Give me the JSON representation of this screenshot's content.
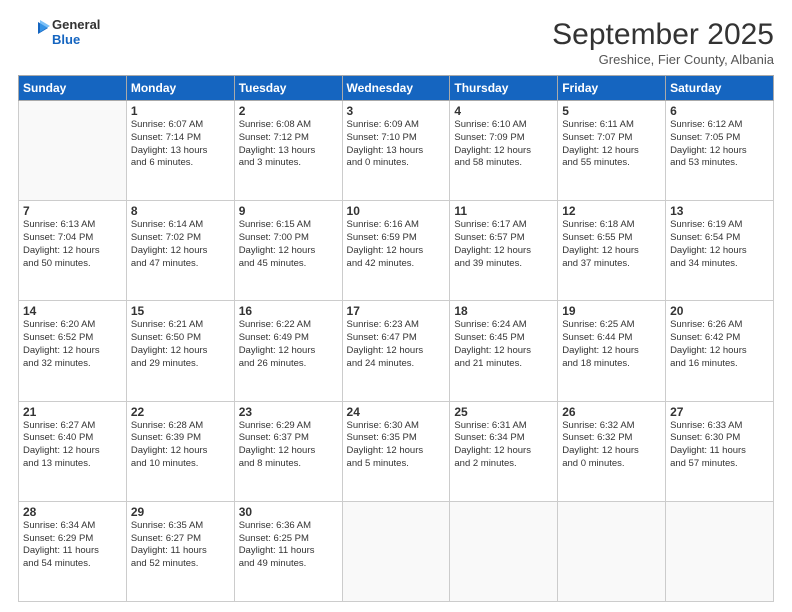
{
  "logo": {
    "text_general": "General",
    "text_blue": "Blue"
  },
  "header": {
    "month": "September 2025",
    "location": "Greshice, Fier County, Albania"
  },
  "days_of_week": [
    "Sunday",
    "Monday",
    "Tuesday",
    "Wednesday",
    "Thursday",
    "Friday",
    "Saturday"
  ],
  "weeks": [
    [
      {
        "day": "",
        "info": ""
      },
      {
        "day": "1",
        "info": "Sunrise: 6:07 AM\nSunset: 7:14 PM\nDaylight: 13 hours\nand 6 minutes."
      },
      {
        "day": "2",
        "info": "Sunrise: 6:08 AM\nSunset: 7:12 PM\nDaylight: 13 hours\nand 3 minutes."
      },
      {
        "day": "3",
        "info": "Sunrise: 6:09 AM\nSunset: 7:10 PM\nDaylight: 13 hours\nand 0 minutes."
      },
      {
        "day": "4",
        "info": "Sunrise: 6:10 AM\nSunset: 7:09 PM\nDaylight: 12 hours\nand 58 minutes."
      },
      {
        "day": "5",
        "info": "Sunrise: 6:11 AM\nSunset: 7:07 PM\nDaylight: 12 hours\nand 55 minutes."
      },
      {
        "day": "6",
        "info": "Sunrise: 6:12 AM\nSunset: 7:05 PM\nDaylight: 12 hours\nand 53 minutes."
      }
    ],
    [
      {
        "day": "7",
        "info": "Sunrise: 6:13 AM\nSunset: 7:04 PM\nDaylight: 12 hours\nand 50 minutes."
      },
      {
        "day": "8",
        "info": "Sunrise: 6:14 AM\nSunset: 7:02 PM\nDaylight: 12 hours\nand 47 minutes."
      },
      {
        "day": "9",
        "info": "Sunrise: 6:15 AM\nSunset: 7:00 PM\nDaylight: 12 hours\nand 45 minutes."
      },
      {
        "day": "10",
        "info": "Sunrise: 6:16 AM\nSunset: 6:59 PM\nDaylight: 12 hours\nand 42 minutes."
      },
      {
        "day": "11",
        "info": "Sunrise: 6:17 AM\nSunset: 6:57 PM\nDaylight: 12 hours\nand 39 minutes."
      },
      {
        "day": "12",
        "info": "Sunrise: 6:18 AM\nSunset: 6:55 PM\nDaylight: 12 hours\nand 37 minutes."
      },
      {
        "day": "13",
        "info": "Sunrise: 6:19 AM\nSunset: 6:54 PM\nDaylight: 12 hours\nand 34 minutes."
      }
    ],
    [
      {
        "day": "14",
        "info": "Sunrise: 6:20 AM\nSunset: 6:52 PM\nDaylight: 12 hours\nand 32 minutes."
      },
      {
        "day": "15",
        "info": "Sunrise: 6:21 AM\nSunset: 6:50 PM\nDaylight: 12 hours\nand 29 minutes."
      },
      {
        "day": "16",
        "info": "Sunrise: 6:22 AM\nSunset: 6:49 PM\nDaylight: 12 hours\nand 26 minutes."
      },
      {
        "day": "17",
        "info": "Sunrise: 6:23 AM\nSunset: 6:47 PM\nDaylight: 12 hours\nand 24 minutes."
      },
      {
        "day": "18",
        "info": "Sunrise: 6:24 AM\nSunset: 6:45 PM\nDaylight: 12 hours\nand 21 minutes."
      },
      {
        "day": "19",
        "info": "Sunrise: 6:25 AM\nSunset: 6:44 PM\nDaylight: 12 hours\nand 18 minutes."
      },
      {
        "day": "20",
        "info": "Sunrise: 6:26 AM\nSunset: 6:42 PM\nDaylight: 12 hours\nand 16 minutes."
      }
    ],
    [
      {
        "day": "21",
        "info": "Sunrise: 6:27 AM\nSunset: 6:40 PM\nDaylight: 12 hours\nand 13 minutes."
      },
      {
        "day": "22",
        "info": "Sunrise: 6:28 AM\nSunset: 6:39 PM\nDaylight: 12 hours\nand 10 minutes."
      },
      {
        "day": "23",
        "info": "Sunrise: 6:29 AM\nSunset: 6:37 PM\nDaylight: 12 hours\nand 8 minutes."
      },
      {
        "day": "24",
        "info": "Sunrise: 6:30 AM\nSunset: 6:35 PM\nDaylight: 12 hours\nand 5 minutes."
      },
      {
        "day": "25",
        "info": "Sunrise: 6:31 AM\nSunset: 6:34 PM\nDaylight: 12 hours\nand 2 minutes."
      },
      {
        "day": "26",
        "info": "Sunrise: 6:32 AM\nSunset: 6:32 PM\nDaylight: 12 hours\nand 0 minutes."
      },
      {
        "day": "27",
        "info": "Sunrise: 6:33 AM\nSunset: 6:30 PM\nDaylight: 11 hours\nand 57 minutes."
      }
    ],
    [
      {
        "day": "28",
        "info": "Sunrise: 6:34 AM\nSunset: 6:29 PM\nDaylight: 11 hours\nand 54 minutes."
      },
      {
        "day": "29",
        "info": "Sunrise: 6:35 AM\nSunset: 6:27 PM\nDaylight: 11 hours\nand 52 minutes."
      },
      {
        "day": "30",
        "info": "Sunrise: 6:36 AM\nSunset: 6:25 PM\nDaylight: 11 hours\nand 49 minutes."
      },
      {
        "day": "",
        "info": ""
      },
      {
        "day": "",
        "info": ""
      },
      {
        "day": "",
        "info": ""
      },
      {
        "day": "",
        "info": ""
      }
    ]
  ]
}
